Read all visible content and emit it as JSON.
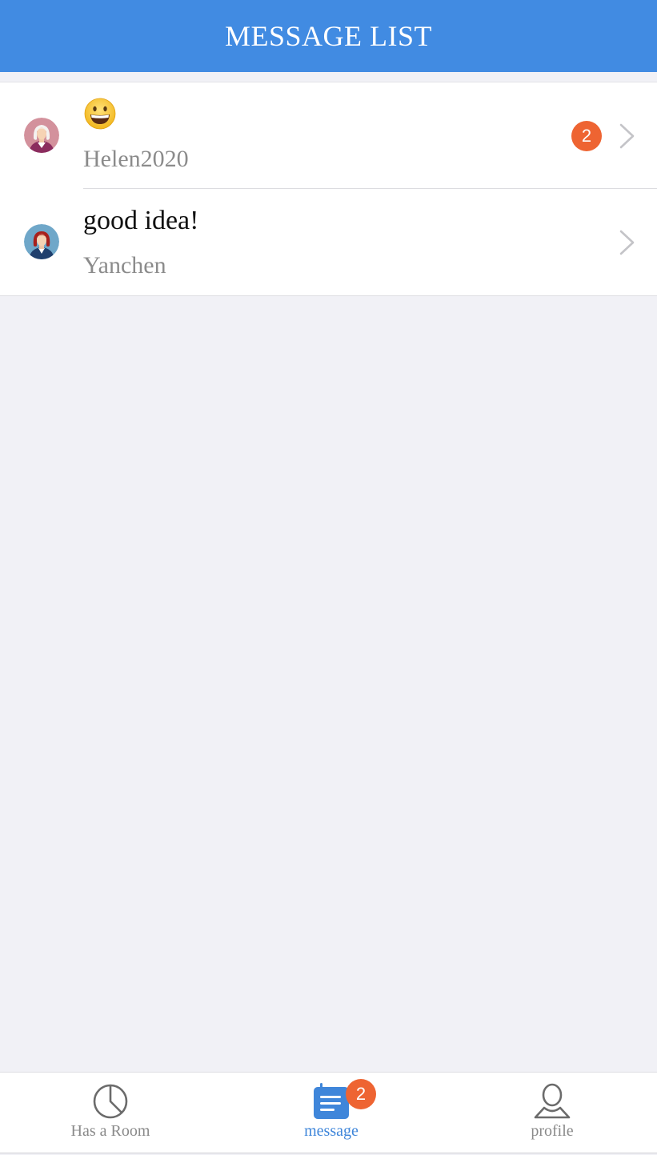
{
  "header": {
    "title": "MESSAGE LIST"
  },
  "conversations": [
    {
      "message": "",
      "message_emoji": "grinning-face",
      "sender": "Helen2020",
      "unread_count": "2",
      "avatar": "woman-white-hair-avatar"
    },
    {
      "message": "good idea!",
      "sender": "Yanchen",
      "unread_count": null,
      "avatar": "woman-red-hair-avatar"
    }
  ],
  "tabbar": {
    "tabs": [
      {
        "label": "Has a Room",
        "icon": "pie-chart-icon",
        "active": false
      },
      {
        "label": "message",
        "icon": "message-list-icon",
        "active": true,
        "badge": "2"
      },
      {
        "label": "profile",
        "icon": "user-icon",
        "active": false
      }
    ]
  },
  "colors": {
    "header_bg": "#418be2",
    "badge": "#ee6432",
    "active_tab": "#3f86da",
    "background": "#f1f1f6"
  }
}
